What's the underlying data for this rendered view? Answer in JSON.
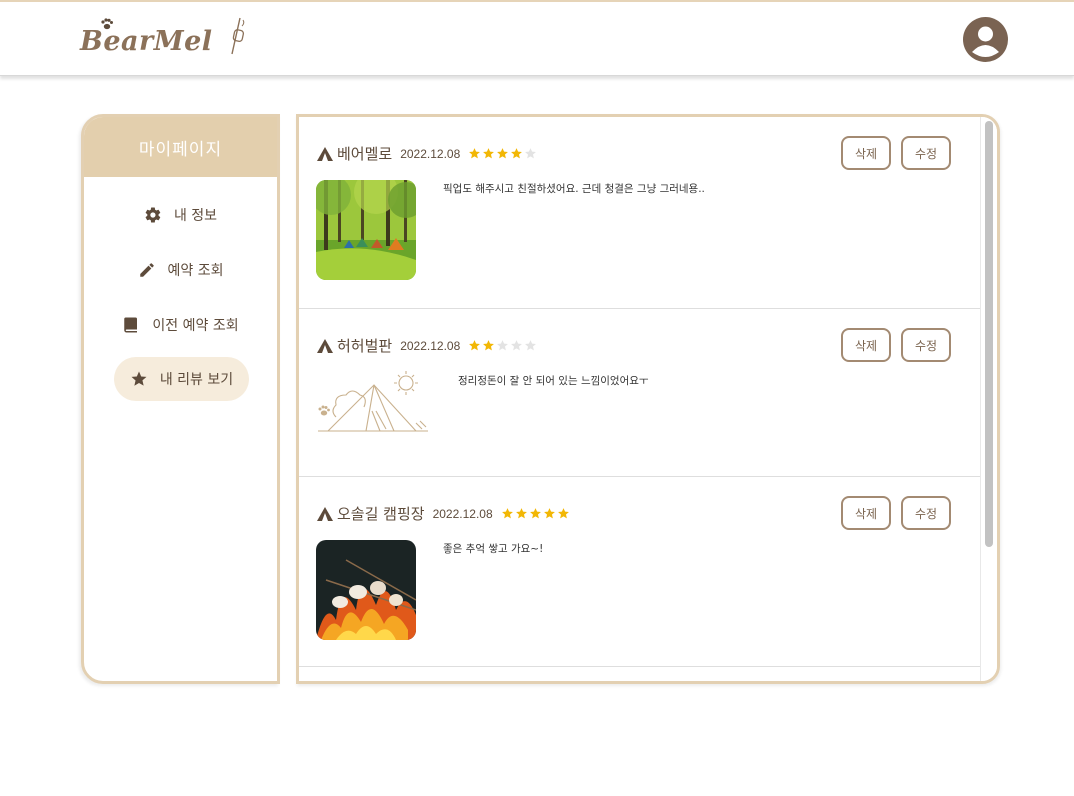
{
  "header": {
    "logo_text": "BearMel",
    "colors": {
      "brand": "#8b7159",
      "accent": "#e3cfad"
    },
    "avatar_icon": "user-circle-icon"
  },
  "sidebar": {
    "title": "마이페이지",
    "items": [
      {
        "label": "내 정보",
        "icon": "gear-icon"
      },
      {
        "label": "예약 조회",
        "icon": "pencil-icon"
      },
      {
        "label": "이전 예약 조회",
        "icon": "book-icon"
      },
      {
        "label": "내 리뷰 보기",
        "icon": "star-icon",
        "active": true
      }
    ]
  },
  "reviews": [
    {
      "name": "베어멜로",
      "date": "2022.12.08",
      "rating": 4,
      "text": "픽업도 해주시고 친절하셨어요. 근데 청결은 그냥 그러네용..",
      "image": "forest-camping-photo",
      "delete_label": "삭제",
      "edit_label": "수정"
    },
    {
      "name": "허허벌판",
      "date": "2022.12.08",
      "rating": 2,
      "text": "정리정돈이 잘 안 되어 있는 느낌이었어요ㅜ",
      "image": "tent-line-illustration",
      "delete_label": "삭제",
      "edit_label": "수정"
    },
    {
      "name": "오솔길 캠핑장",
      "date": "2022.12.08",
      "rating": 5,
      "text": "좋은 추억 쌓고 가요~!",
      "image": "marshmallow-campfire-photo",
      "delete_label": "삭제",
      "edit_label": "수정"
    }
  ]
}
